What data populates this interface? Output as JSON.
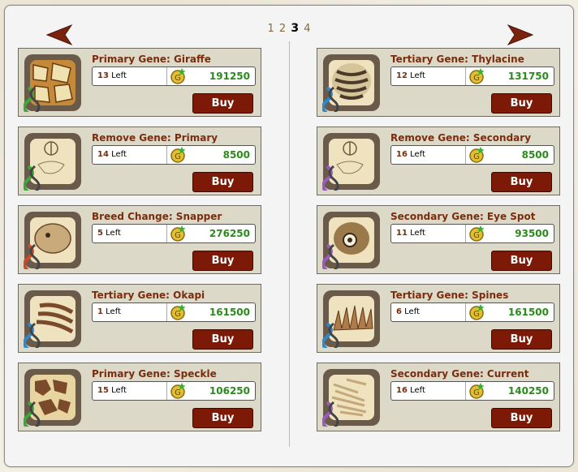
{
  "pagination": {
    "pages": [
      "1",
      "2",
      "3",
      "4"
    ],
    "current": "3"
  },
  "navigation": {
    "prev_icon": "arrow-left-icon",
    "next_icon": "arrow-right-icon",
    "arrow_color": "#7a2410"
  },
  "colors": {
    "title": "#7a2d0d",
    "price": "#2a8a1a",
    "buy_button": "#7c1a07",
    "card_bg": "#dcd9c9"
  },
  "items_left": [
    {
      "title": "Primary Gene: Giraffe",
      "count": "13",
      "left_label": "Left",
      "price": "191250",
      "buy_label": "Buy",
      "thumb_icon": "giraffe-pattern-icon",
      "dna_color": "#3aa83a"
    },
    {
      "title": "Remove Gene: Primary",
      "count": "14",
      "left_label": "Left",
      "price": "8500",
      "buy_label": "Buy",
      "thumb_icon": "sketch-icon",
      "dna_color": "#3aa83a"
    },
    {
      "title": "Breed Change: Snapper",
      "count": "5",
      "left_label": "Left",
      "price": "276250",
      "buy_label": "Buy",
      "thumb_icon": "snapper-icon",
      "dna_color": "#d04a2a"
    },
    {
      "title": "Tertiary Gene: Okapi",
      "count": "1",
      "left_label": "Left",
      "price": "161500",
      "buy_label": "Buy",
      "thumb_icon": "okapi-stripes-icon",
      "dna_color": "#2a8ad0"
    },
    {
      "title": "Primary Gene: Speckle",
      "count": "15",
      "left_label": "Left",
      "price": "106250",
      "buy_label": "Buy",
      "thumb_icon": "speckle-pattern-icon",
      "dna_color": "#3aa83a"
    }
  ],
  "items_right": [
    {
      "title": "Tertiary Gene: Thylacine",
      "count": "12",
      "left_label": "Left",
      "price": "131750",
      "buy_label": "Buy",
      "thumb_icon": "thylacine-stripes-icon",
      "dna_color": "#2a8ad0"
    },
    {
      "title": "Remove Gene: Secondary",
      "count": "16",
      "left_label": "Left",
      "price": "8500",
      "buy_label": "Buy",
      "thumb_icon": "sketch-icon",
      "dna_color": "#9a5ac0"
    },
    {
      "title": "Secondary Gene: Eye Spot",
      "count": "11",
      "left_label": "Left",
      "price": "93500",
      "buy_label": "Buy",
      "thumb_icon": "eye-spot-icon",
      "dna_color": "#9a5ac0"
    },
    {
      "title": "Tertiary Gene: Spines",
      "count": "6",
      "left_label": "Left",
      "price": "161500",
      "buy_label": "Buy",
      "thumb_icon": "spines-icon",
      "dna_color": "#2a8ad0"
    },
    {
      "title": "Secondary Gene: Current",
      "count": "16",
      "left_label": "Left",
      "price": "140250",
      "buy_label": "Buy",
      "thumb_icon": "current-pattern-icon",
      "dna_color": "#9a5ac0"
    }
  ]
}
